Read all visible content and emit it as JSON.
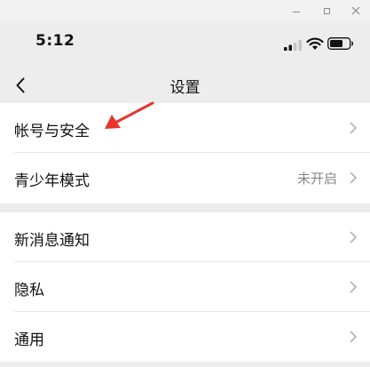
{
  "status_bar": {
    "time": "5:12"
  },
  "nav": {
    "title": "设置"
  },
  "groups": [
    {
      "items": [
        {
          "label": "帐号与安全",
          "value": ""
        },
        {
          "label": "青少年模式",
          "value": "未开启"
        }
      ]
    },
    {
      "items": [
        {
          "label": "新消息通知",
          "value": ""
        },
        {
          "label": "隐私",
          "value": ""
        },
        {
          "label": "通用",
          "value": ""
        }
      ]
    }
  ],
  "colors": {
    "background": "#ededed",
    "row_background": "#ffffff",
    "secondary_text": "#888888",
    "annotation_arrow": "#e8342a"
  }
}
